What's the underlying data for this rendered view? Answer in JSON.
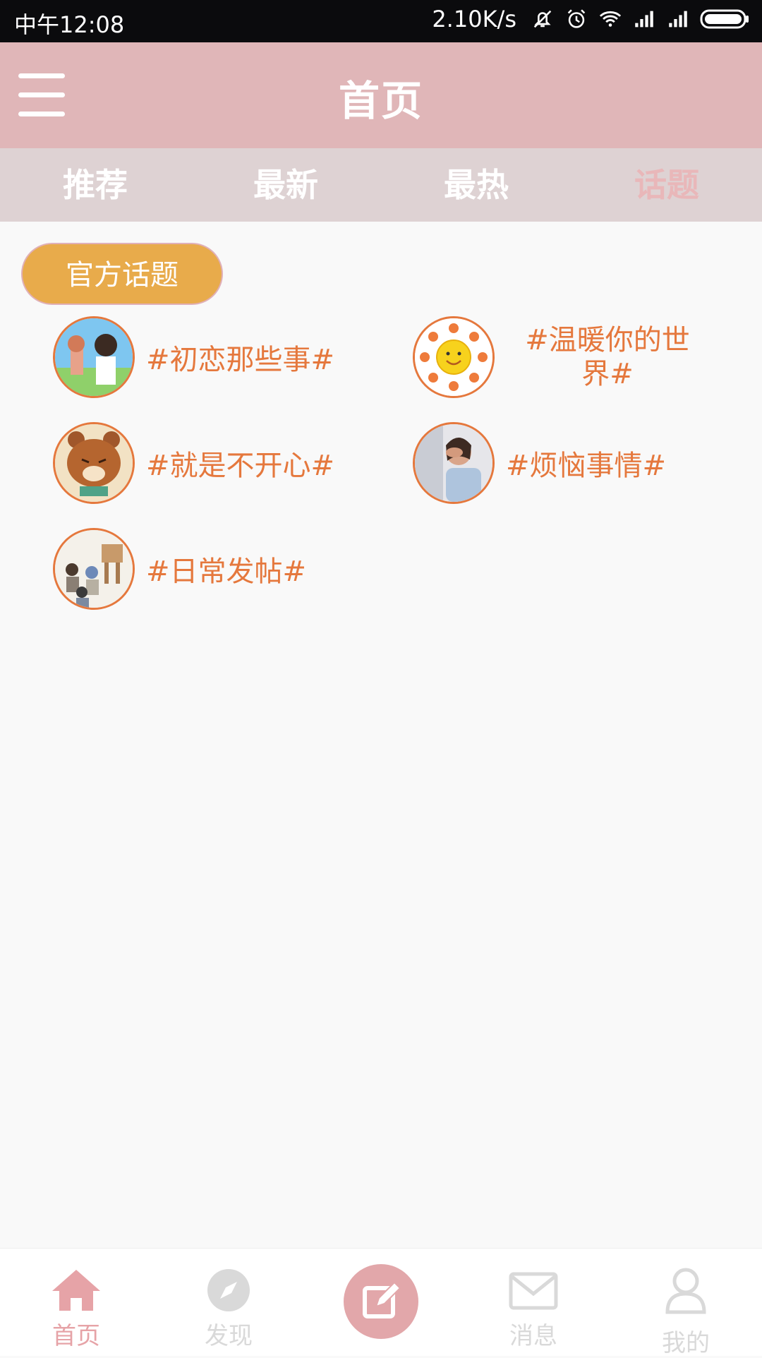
{
  "status_bar": {
    "time": "中午12:08",
    "speed": "2.10K/s",
    "icons": [
      "bell-off-icon",
      "alarm-icon",
      "wifi-icon",
      "signal-icon",
      "signal-icon",
      "battery-icon"
    ]
  },
  "header": {
    "title": "首页",
    "menu_icon": "hamburger-menu-icon"
  },
  "tabs": [
    {
      "label": "推荐"
    },
    {
      "label": "最新"
    },
    {
      "label": "最热"
    },
    {
      "label": "话题"
    }
  ],
  "active_tab": "话题",
  "section": {
    "button_label": "官方话题"
  },
  "topics": [
    {
      "label": "#初恋那些事#"
    },
    {
      "label": "#温暖你的世界#"
    },
    {
      "label": "#就是不开心#"
    },
    {
      "label": "#烦恼事情#"
    },
    {
      "label": "#日常发帖#"
    }
  ],
  "bottom_nav": [
    {
      "label": "首页",
      "icon": "home-icon"
    },
    {
      "label": "发现",
      "icon": "compass-icon"
    },
    {
      "label": "",
      "icon": "compose-icon"
    },
    {
      "label": "消息",
      "icon": "mail-icon"
    },
    {
      "label": "我的",
      "icon": "user-icon"
    }
  ],
  "colors": {
    "header_bg": "#e0b6b8",
    "tabbar_bg": "#ded2d3",
    "accent_text": "#e5783d",
    "button_bg": "#e8ab4b",
    "active_tab": "#e9b7b9"
  }
}
